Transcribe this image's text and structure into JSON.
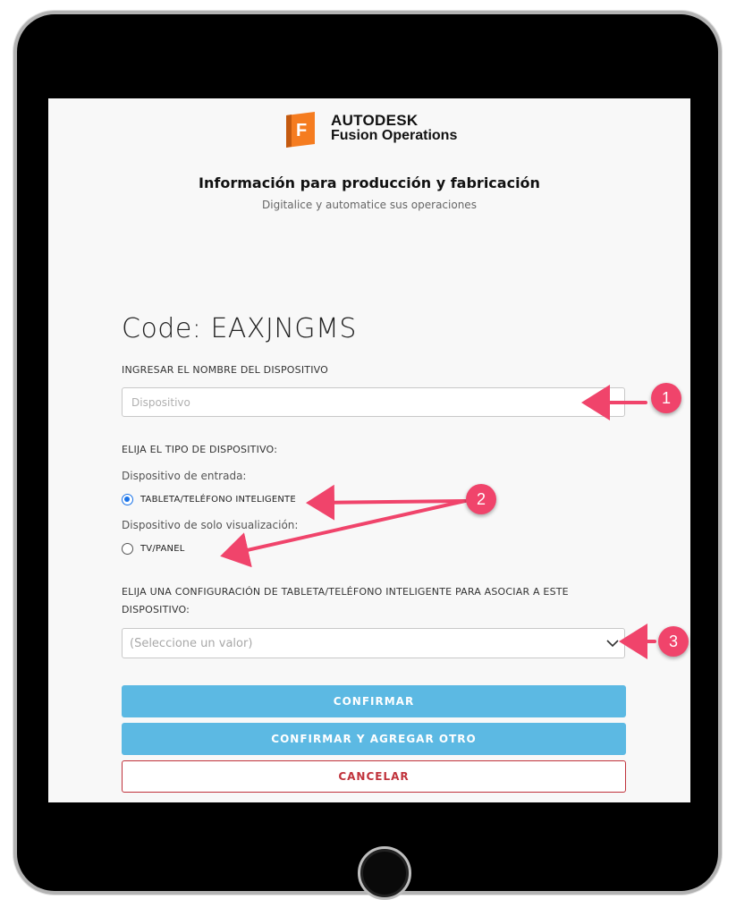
{
  "brand": {
    "line1": "AUTODESK",
    "line2": "Fusion Operations",
    "logo_letter": "F"
  },
  "header": {
    "title": "Información para producción y fabricación",
    "subtitle": "Digitalice y automatice sus operaciones"
  },
  "form": {
    "code": "Code: EAXJNGMS",
    "device_name_label": "INGRESAR EL NOMBRE DEL DISPOSITIVO",
    "device_name_placeholder": "Dispositivo",
    "device_name_value": "",
    "device_type_label": "ELIJA EL TIPO DE DISPOSITIVO:",
    "input_device_label": "Dispositivo de entrada:",
    "radio_tablet": {
      "label": "TABLETA/TELÉFONO INTELIGENTE",
      "selected": true
    },
    "view_only_label": "Dispositivo de solo visualización:",
    "radio_tv": {
      "label": "TV/PANEL",
      "selected": false
    },
    "config_label_line1": "ELIJA UNA CONFIGURACIÓN DE TABLETA/TELÉFONO INTELIGENTE PARA ASOCIAR A ESTE",
    "config_label_line2": "DISPOSITIVO:",
    "config_select_value": "(Seleccione un valor)"
  },
  "buttons": {
    "confirm": "CONFIRMAR",
    "confirm_add": "CONFIRMAR Y AGREGAR OTRO",
    "cancel": "CANCELAR"
  },
  "annotations": {
    "badge1": "1",
    "badge2": "2",
    "badge3": "3"
  },
  "colors": {
    "primary_button": "#5cb9e3",
    "cancel_text": "#c0323b",
    "annotation": "#f0446b",
    "radio_selected": "#1a73e8",
    "logo_orange": "#f57c20"
  }
}
